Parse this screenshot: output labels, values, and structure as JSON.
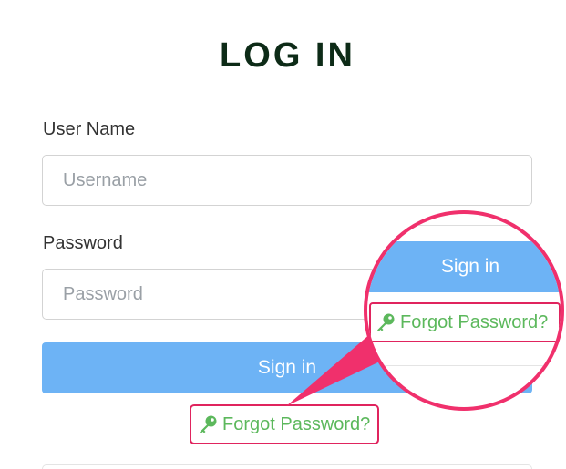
{
  "page": {
    "title": "LOG IN"
  },
  "form": {
    "username_label": "User Name",
    "username_placeholder": "Username",
    "username_value": "",
    "password_label": "Password",
    "password_placeholder": "Password",
    "password_value": "",
    "signin_label": "Sign in",
    "forgot_label": "Forgot Password?"
  },
  "callout": {
    "signin_label": "Sign in",
    "forgot_label": "Forgot Password?"
  },
  "icons": {
    "key": "key-icon"
  },
  "colors": {
    "title": "#0d2b17",
    "signin_bg": "#6db3f5",
    "link_green": "#5cb85c",
    "highlight_pink": "#f0306c"
  }
}
